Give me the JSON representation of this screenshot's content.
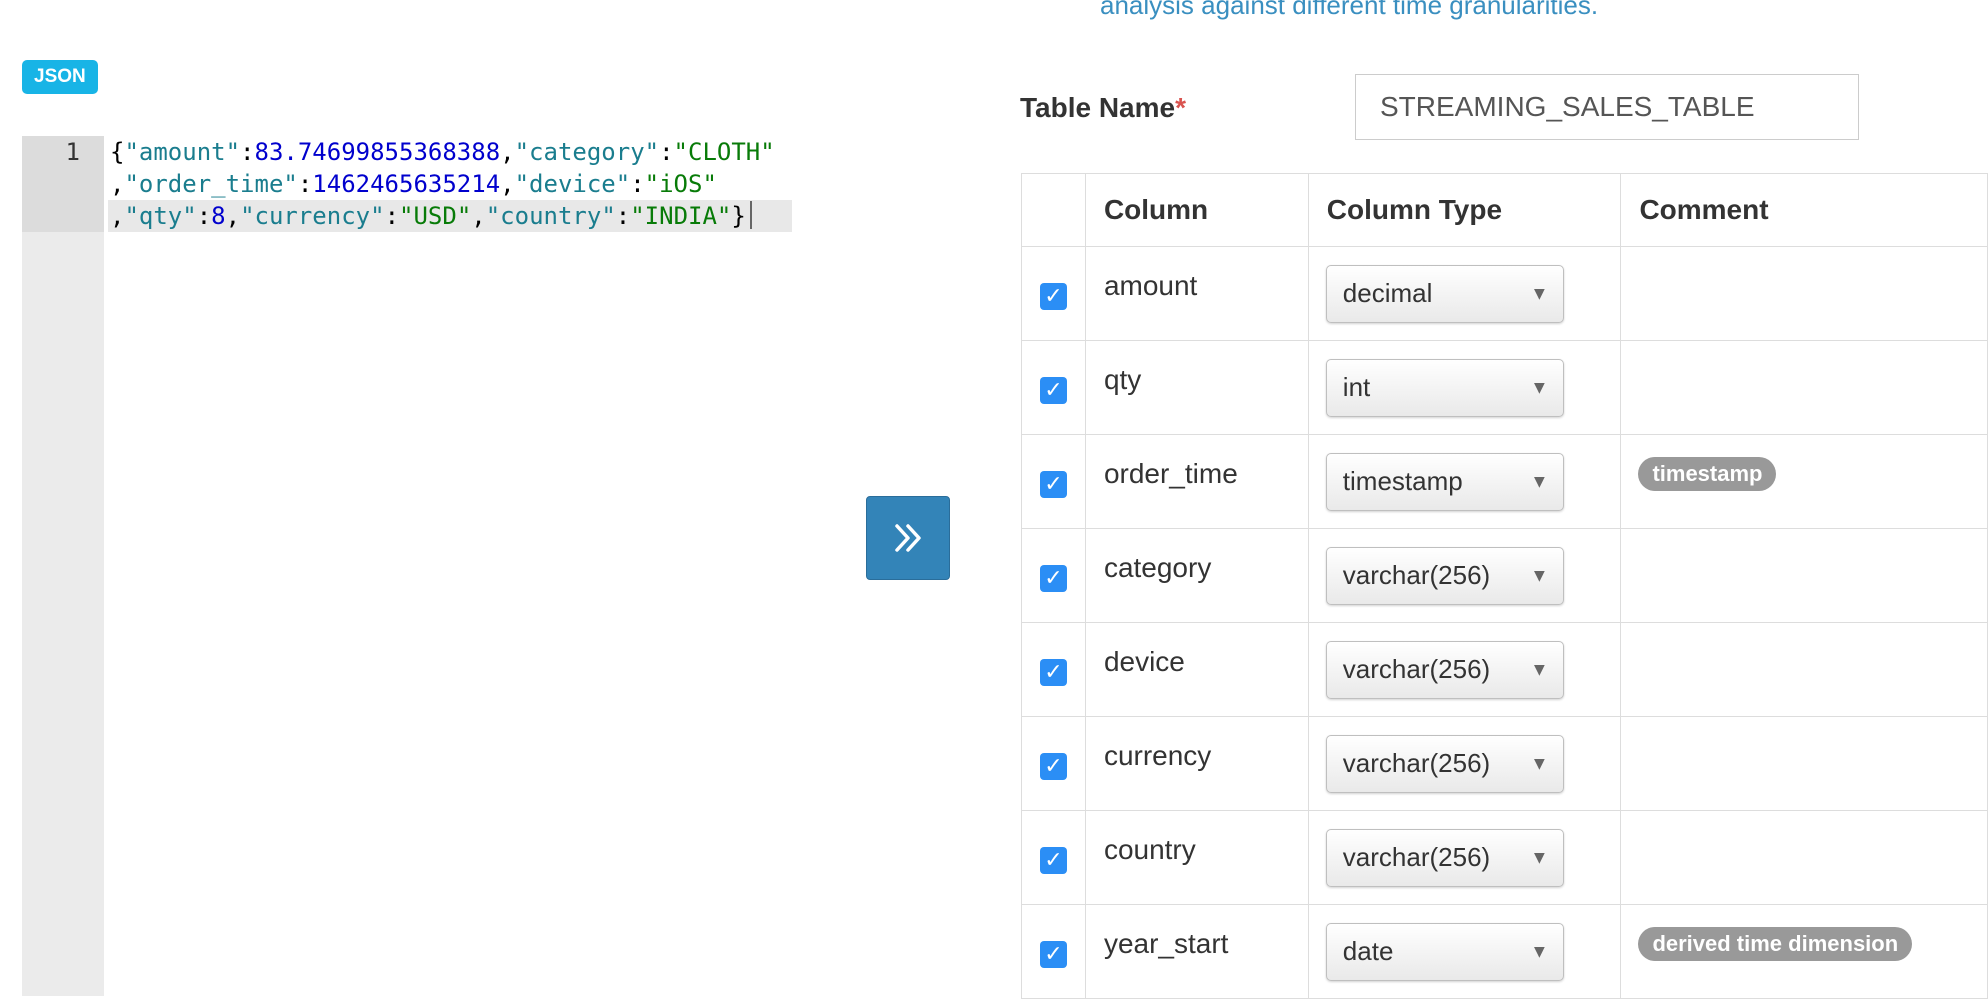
{
  "top_hint": "analysis against different time granularities.",
  "json_badge": "JSON",
  "editor": {
    "line_number": "1",
    "lines": [
      [
        {
          "t": "{",
          "c": ""
        },
        {
          "t": "\"amount\"",
          "c": "k"
        },
        {
          "t": ":",
          "c": ""
        },
        {
          "t": "83.74699855368388",
          "c": "n"
        },
        {
          "t": ",",
          "c": ""
        },
        {
          "t": "\"category\"",
          "c": "k"
        },
        {
          "t": ":",
          "c": ""
        },
        {
          "t": "\"CLOTH\"",
          "c": "s"
        }
      ],
      [
        {
          "t": ",",
          "c": ""
        },
        {
          "t": "\"order_time\"",
          "c": "k"
        },
        {
          "t": ":",
          "c": ""
        },
        {
          "t": "1462465635214",
          "c": "n"
        },
        {
          "t": ",",
          "c": ""
        },
        {
          "t": "\"device\"",
          "c": "k"
        },
        {
          "t": ":",
          "c": ""
        },
        {
          "t": "\"iOS\"",
          "c": "s"
        }
      ],
      [
        {
          "t": ",",
          "c": ""
        },
        {
          "t": "\"qty\"",
          "c": "k"
        },
        {
          "t": ":",
          "c": ""
        },
        {
          "t": "8",
          "c": "n"
        },
        {
          "t": ",",
          "c": ""
        },
        {
          "t": "\"currency\"",
          "c": "k"
        },
        {
          "t": ":",
          "c": ""
        },
        {
          "t": "\"USD\"",
          "c": "s"
        },
        {
          "t": ",",
          "c": ""
        },
        {
          "t": "\"country\"",
          "c": "k"
        },
        {
          "t": ":",
          "c": ""
        },
        {
          "t": "\"INDIA\"",
          "c": "s"
        },
        {
          "t": "}",
          "c": ""
        }
      ]
    ]
  },
  "transfer_button_icon": "double-chevron-right-icon",
  "table_name": {
    "label": "Table Name",
    "required_mark": "*",
    "value": "STREAMING_SALES_TABLE"
  },
  "columns_table": {
    "headers": [
      "",
      "Column",
      "Column Type",
      "Comment"
    ],
    "rows": [
      {
        "checked": true,
        "name": "amount",
        "type": "decimal",
        "comment": ""
      },
      {
        "checked": true,
        "name": "qty",
        "type": "int",
        "comment": ""
      },
      {
        "checked": true,
        "name": "order_time",
        "type": "timestamp",
        "comment": "timestamp"
      },
      {
        "checked": true,
        "name": "category",
        "type": "varchar(256)",
        "comment": ""
      },
      {
        "checked": true,
        "name": "device",
        "type": "varchar(256)",
        "comment": ""
      },
      {
        "checked": true,
        "name": "currency",
        "type": "varchar(256)",
        "comment": ""
      },
      {
        "checked": true,
        "name": "country",
        "type": "varchar(256)",
        "comment": ""
      },
      {
        "checked": true,
        "name": "year_start",
        "type": "date",
        "comment": "derived time dimension"
      }
    ]
  },
  "colors": {
    "badge": "#18b4e6",
    "button": "#3384b8",
    "checkbox": "#2b8ef5",
    "tag": "#999999",
    "required": "#d9534f"
  }
}
